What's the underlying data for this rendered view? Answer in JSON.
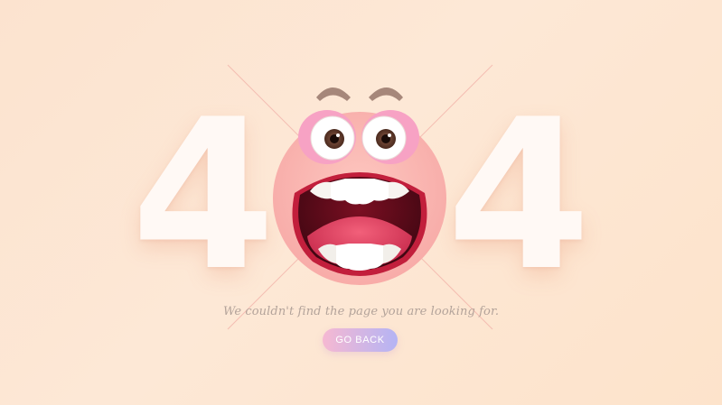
{
  "error_code": {
    "left_digit": "4",
    "right_digit": "4"
  },
  "message": "We couldn't find the page you are looking for.",
  "go_back": {
    "label": "GO BACK"
  },
  "colors": {
    "background": "#fde5d1",
    "digit": "#fff9f5",
    "face": "#fbb8b4",
    "button_start": "#f6b8d2",
    "button_end": "#b4b4f4",
    "message_text": "#b3a39a"
  }
}
